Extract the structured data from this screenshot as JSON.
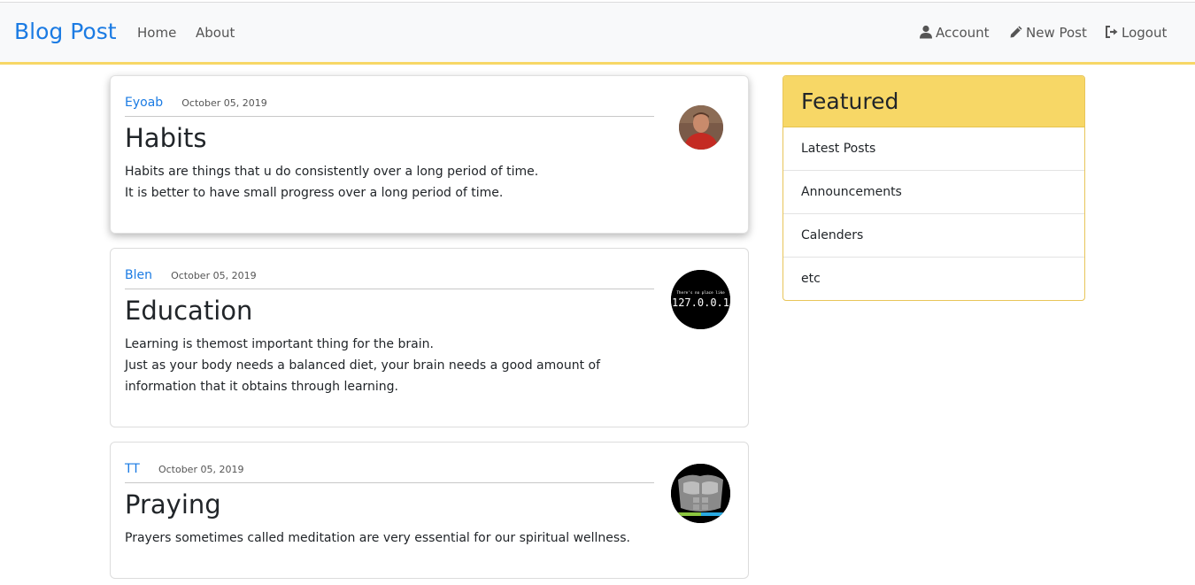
{
  "navbar": {
    "brand": "Blog Post",
    "links": [
      "Home",
      "About"
    ],
    "right": [
      {
        "label": "Account",
        "icon": "user-icon"
      },
      {
        "label": "New Post",
        "icon": "pencil-icon"
      },
      {
        "label": "Logout",
        "icon": "sign-out-icon"
      }
    ]
  },
  "posts": [
    {
      "author": "Eyoab",
      "date": "October 05, 2019",
      "title": "Habits",
      "lines": [
        "Habits are things that u do consistently over a long period of time.",
        "It is better to have small progress over a long period of time."
      ],
      "avatar": "person-avatar"
    },
    {
      "author": "Blen",
      "date": "October 05, 2019",
      "title": "Education",
      "lines": [
        "Learning is themost important thing for the brain.",
        "Just as your body needs a balanced diet, your brain needs a good amount of information that it obtains through learning."
      ],
      "avatar": "localhost-avatar",
      "avatar_text_small": "There's no place like",
      "avatar_text_big": "127.0.0.1"
    },
    {
      "author": "TT",
      "date": "October 05, 2019",
      "title": "Praying",
      "lines": [
        "Prayers sometimes called meditation are very essential for our spiritual wellness."
      ],
      "avatar": "fitness-avatar"
    }
  ],
  "featured": {
    "title": "Featured",
    "items": [
      "Latest Posts",
      "Announcements",
      "Calenders",
      "etc"
    ]
  },
  "colors": {
    "brand": "#1b7be3",
    "accent": "#f7d766"
  }
}
